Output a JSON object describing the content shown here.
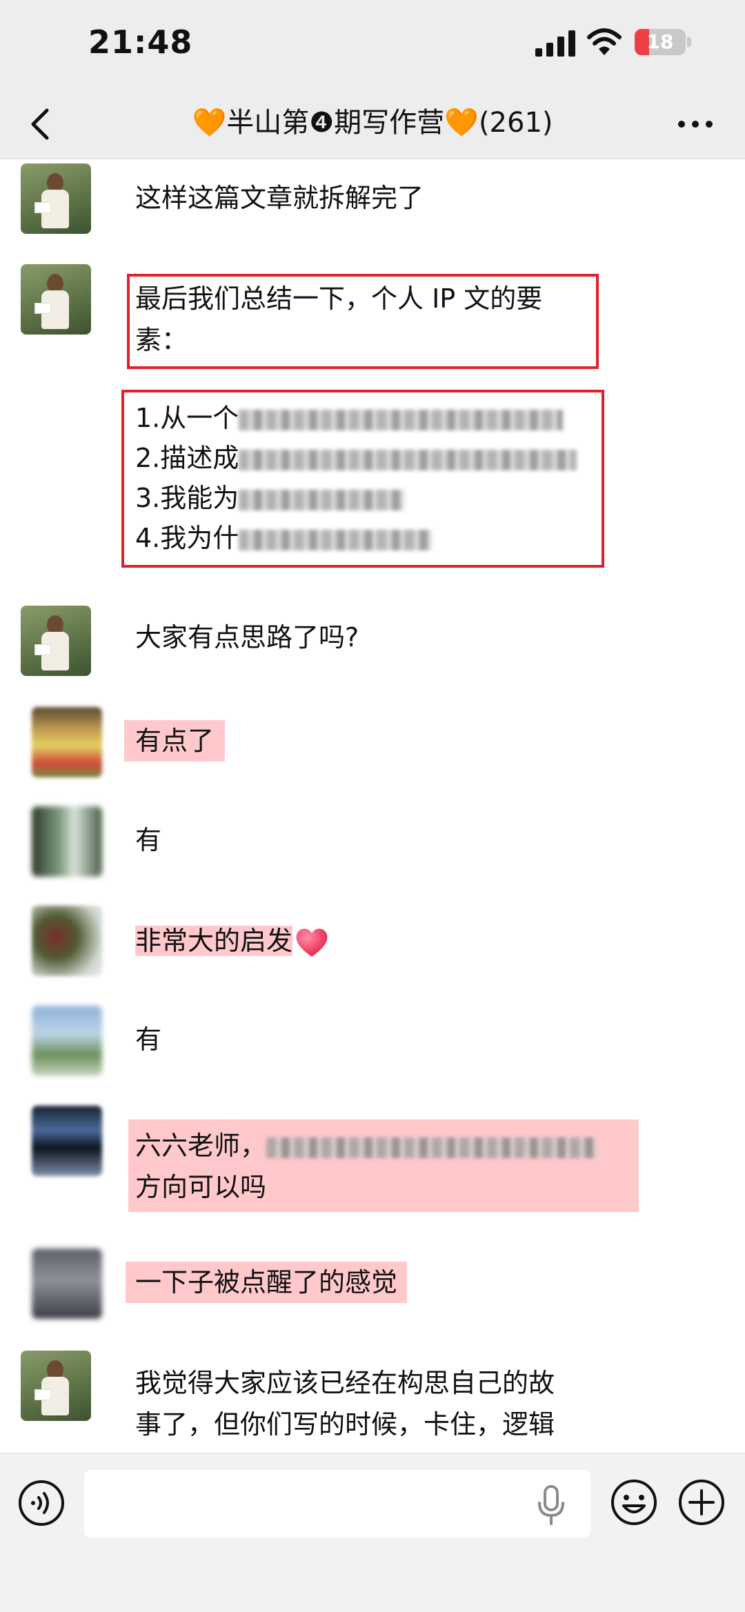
{
  "status_bar": {
    "time": "21:48",
    "battery": "18",
    "battery_level": 0.18
  },
  "header": {
    "title": "🧡半山第❹期写作营🧡(261)",
    "back_icon": "chevron-left-icon",
    "more_icon": "ellipsis-icon"
  },
  "messages": {
    "m1": "这样这篇文章就拆解完了",
    "m2_line1": "最后我们总结一下，个人 IP 文的要",
    "m2_line2": "素：",
    "m3_item1": "1.从一个",
    "m3_item2": "2.描述成",
    "m3_item3": "3.我能为",
    "m3_item4": "4.我为什",
    "m4": "大家有点思路了吗?",
    "m5": "有点了",
    "m6": "有",
    "m7": "非常大的启发",
    "m8": "有",
    "m9_line1": "六六老师，",
    "m9_line2": "方向可以吗",
    "m10": "一下子被点醒了的感觉",
    "m11_line1": "我觉得大家应该已经在构思自己的故",
    "m11_line2": "事了，但你们写的时候，卡住，逻辑"
  },
  "colors": {
    "highlight": "#ffc9cc",
    "red_box": "#e0212b",
    "bar_bg": "#ededed"
  },
  "input_bar": {
    "placeholder": "",
    "icons": [
      "voice-icon",
      "mic-icon",
      "emoji-icon",
      "plus-icon"
    ]
  }
}
